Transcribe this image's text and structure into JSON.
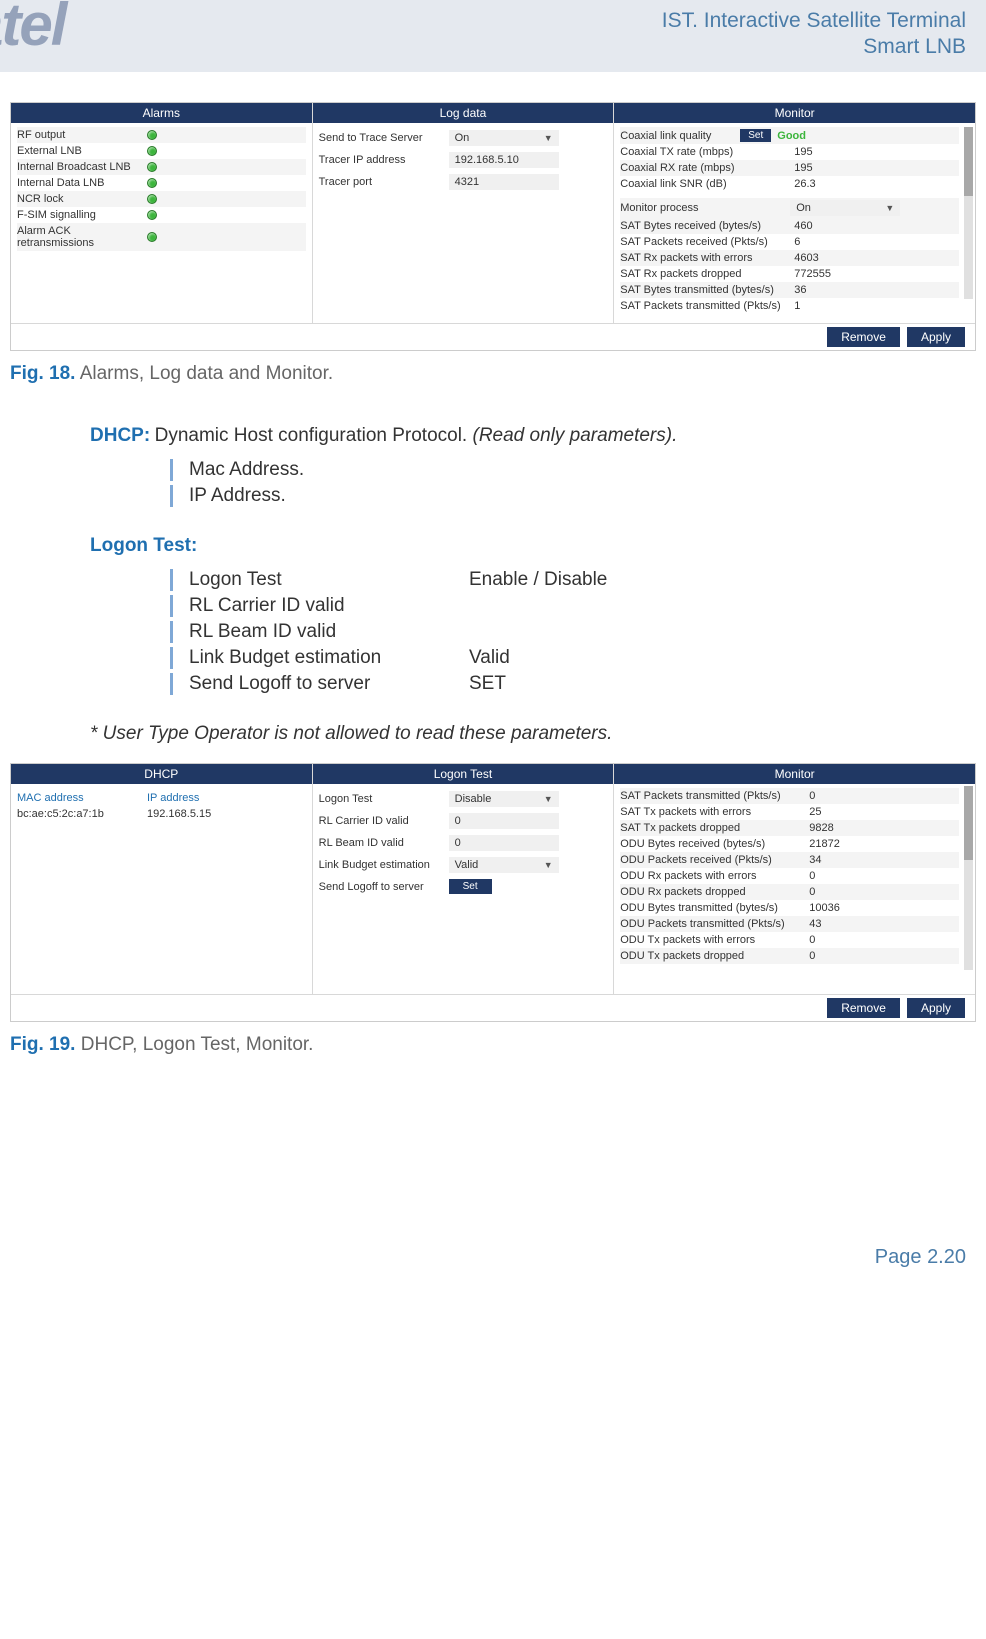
{
  "header": {
    "logo_text": "atel",
    "title_line1": "IST. Interactive Satellite Terminal",
    "title_line2": "Smart LNB"
  },
  "fig18": {
    "alarms_title": "Alarms",
    "logdata_title": "Log data",
    "monitor_title": "Monitor",
    "alarms": [
      "RF output",
      "External LNB",
      "Internal Broadcast LNB",
      "Internal Data LNB",
      "NCR lock",
      "F-SIM signalling",
      "Alarm ACK retransmissions"
    ],
    "logdata": [
      {
        "label": "Send to Trace Server",
        "value": "On",
        "dropdown": true
      },
      {
        "label": "Tracer IP address",
        "value": "192.168.5.10"
      },
      {
        "label": "Tracer port",
        "value": "4321"
      }
    ],
    "monitor_top": {
      "label": "Coaxial link quality",
      "btn": "Set",
      "val": "Good"
    },
    "monitor": [
      {
        "label": "Coaxial TX rate (mbps)",
        "val": "195"
      },
      {
        "label": "Coaxial RX rate (mbps)",
        "val": "195"
      },
      {
        "label": "Coaxial link SNR (dB)",
        "val": "26.3"
      }
    ],
    "monitor_proc": {
      "label": "Monitor process",
      "val": "On"
    },
    "monitor2": [
      {
        "label": "SAT Bytes received (bytes/s)",
        "val": "460"
      },
      {
        "label": "SAT Packets received (Pkts/s)",
        "val": "6"
      },
      {
        "label": "SAT Rx packets with errors",
        "val": "4603"
      },
      {
        "label": "SAT Rx packets dropped",
        "val": "772555"
      },
      {
        "label": "SAT Bytes transmitted (bytes/s)",
        "val": "36"
      },
      {
        "label": "SAT Packets transmitted (Pkts/s)",
        "val": "1"
      }
    ],
    "remove_btn": "Remove",
    "apply_btn": "Apply",
    "caption_b": "Fig. 18.",
    "caption": " Alarms, Log data and Monitor."
  },
  "dhcp_section": {
    "title": "DHCP:",
    "desc": " Dynamic Host configuration Protocol. ",
    "desc_em": "(Read only parameters).",
    "items": [
      "Mac Address.",
      "IP Address."
    ]
  },
  "logon_section": {
    "title": "Logon Test:",
    "rows": [
      {
        "label": "Logon Test",
        "val": "Enable / Disable"
      },
      {
        "label": "RL Carrier ID valid",
        "val": ""
      },
      {
        "label": "RL Beam ID valid",
        "val": ""
      },
      {
        "label": "Link Budget estimation",
        "val": "Valid"
      },
      {
        "label": "Send Logoff to server",
        "val": "SET"
      }
    ]
  },
  "note": "* User Type Operator is not allowed to read these parameters.",
  "fig19": {
    "dhcp_title": "DHCP",
    "logon_title": "Logon Test",
    "monitor_title": "Monitor",
    "dhcp_cols": {
      "mac_h": "MAC address",
      "ip_h": "IP address"
    },
    "dhcp_row": {
      "mac": "bc:ae:c5:2c:a7:1b",
      "ip": "192.168.5.15"
    },
    "logon": [
      {
        "label": "Logon Test",
        "val": "Disable",
        "dropdown": true
      },
      {
        "label": "RL Carrier ID valid",
        "val": "0"
      },
      {
        "label": "RL Beam ID valid",
        "val": "0"
      },
      {
        "label": "Link Budget estimation",
        "val": "Valid",
        "dropdown": true
      }
    ],
    "logon_send": {
      "label": "Send Logoff to server",
      "btn": "Set"
    },
    "monitor": [
      {
        "label": "SAT Packets transmitted (Pkts/s)",
        "val": "0",
        "alt": true
      },
      {
        "label": "SAT Tx packets with errors",
        "val": "25"
      },
      {
        "label": "SAT Tx packets dropped",
        "val": "9828",
        "alt": true
      },
      {
        "label": "ODU Bytes received (bytes/s)",
        "val": "21872"
      },
      {
        "label": "ODU Packets received (Pkts/s)",
        "val": "34",
        "alt": true
      },
      {
        "label": "ODU Rx packets with errors",
        "val": "0"
      },
      {
        "label": "ODU Rx packets dropped",
        "val": "0",
        "alt": true
      },
      {
        "label": "ODU Bytes transmitted (bytes/s)",
        "val": "10036"
      },
      {
        "label": "ODU Packets transmitted (Pkts/s)",
        "val": "43",
        "alt": true
      },
      {
        "label": "ODU Tx packets with errors",
        "val": "0"
      },
      {
        "label": "ODU Tx packets dropped",
        "val": "0",
        "alt": true
      }
    ],
    "remove_btn": "Remove",
    "apply_btn": "Apply",
    "caption_b": "Fig. 19.",
    "caption": " DHCP, Logon Test, Monitor."
  },
  "footer": "Page 2.20"
}
